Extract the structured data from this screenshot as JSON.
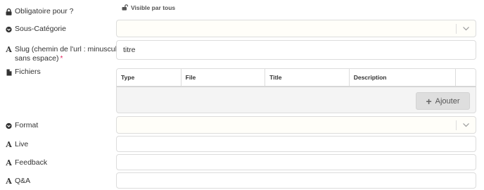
{
  "fields": {
    "obligatoire": {
      "label": "Obligatoire pour ?",
      "badge": "Visible par tous"
    },
    "sous_categorie": {
      "label": "Sous-Catégorie"
    },
    "slug": {
      "label_line1": "Slug (chemin de l'url : minuscules,",
      "label_line2": "sans espace)",
      "required_mark": "*",
      "value": "titre"
    },
    "fichiers": {
      "label": "Fichiers",
      "columns": [
        "Type",
        "File",
        "Title",
        "Description"
      ],
      "add_button": "Ajouter",
      "add_icon": "+"
    },
    "format": {
      "label": "Format"
    },
    "live": {
      "label": "Live"
    },
    "feedback": {
      "label": "Feedback"
    },
    "qa": {
      "label": "Q&A"
    }
  },
  "icons": {
    "text_field": "A",
    "lock": "lock-icon",
    "chevron_circle": "chevron-circle-down-icon",
    "file": "file-icon",
    "unlock": "unlock-icon",
    "chevron": "chevron-down-icon"
  }
}
